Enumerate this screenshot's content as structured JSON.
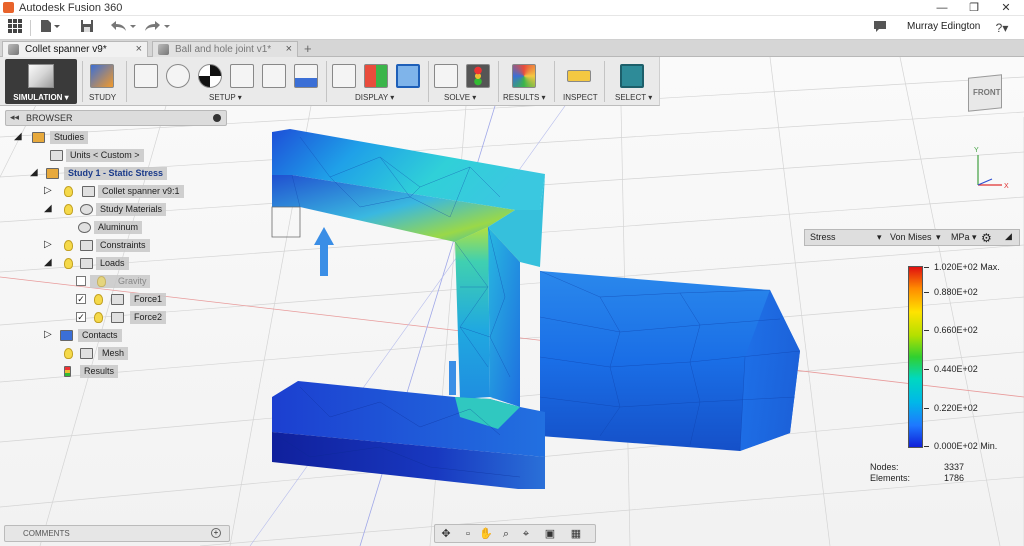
{
  "window": {
    "title": "Autodesk Fusion 360",
    "controls": [
      "—",
      "❐",
      "✕"
    ]
  },
  "quick_access": {
    "user_name": "Murray Edington",
    "help": "?▾",
    "icons": [
      "grid-icon",
      "file-icon",
      "save-icon",
      "undo-icon",
      "redo-icon"
    ]
  },
  "tabs": [
    {
      "label": "Collet spanner v9*",
      "close": "×",
      "active": true
    },
    {
      "label": "Ball and hole joint v1*",
      "close": "×",
      "active": false
    }
  ],
  "tab_add": "+",
  "toolbar": {
    "workspace": "SIMULATION ▾",
    "groups": {
      "study": "STUDY",
      "setup": "SETUP ▾",
      "display": "DISPLAY ▾",
      "solve": "SOLVE ▾",
      "results": "RESULTS ▾",
      "inspect": "INSPECT",
      "select": "SELECT ▾"
    }
  },
  "browser": {
    "title": "BROWSER",
    "collapse": "◂◂",
    "nodes": [
      {
        "label": "Studies",
        "arrow": "◢"
      },
      {
        "label": "Units < Custom >"
      },
      {
        "label": "Study 1 - Static Stress",
        "arrow": "◢"
      },
      {
        "label": "Collet spanner v9:1",
        "arrow": "▷"
      },
      {
        "label": "Study Materials",
        "arrow": "◢"
      },
      {
        "label": "Aluminum"
      },
      {
        "label": "Constraints",
        "arrow": "▷"
      },
      {
        "label": "Loads",
        "arrow": "◢"
      },
      {
        "label": "Gravity"
      },
      {
        "label": "Force1",
        "check": "✓"
      },
      {
        "label": "Force2",
        "check": "✓"
      },
      {
        "label": "Contacts",
        "arrow": "▷"
      },
      {
        "label": "Mesh"
      },
      {
        "label": "Results"
      }
    ]
  },
  "result_selector": {
    "type": "Stress",
    "type_arrow": "▾",
    "criterion": "Von Mises",
    "criterion_arrow": "▾",
    "unit": "MPa ▾"
  },
  "legend": {
    "max_label": "1.020E+02 Max.",
    "min_label": "0.000E+02 Min.",
    "ticks": [
      "0.880E+02",
      "0.660E+02",
      "0.440E+02",
      "0.220E+02"
    ],
    "colors": {
      "max": "#e01010",
      "min": "#1020d8"
    }
  },
  "stats": {
    "nodes_label": "Nodes:",
    "nodes_value": "3337",
    "elements_label": "Elements:",
    "elements_value": "1786"
  },
  "viewcube": {
    "face": "FRONT"
  },
  "comments": {
    "title": "COMMENTS",
    "add": "+"
  },
  "navbar": {
    "icons": [
      "orbit-icon",
      "pan-icon",
      "zoom-icon",
      "fit-icon",
      "display-settings-icon",
      "grid-settings-icon"
    ]
  }
}
